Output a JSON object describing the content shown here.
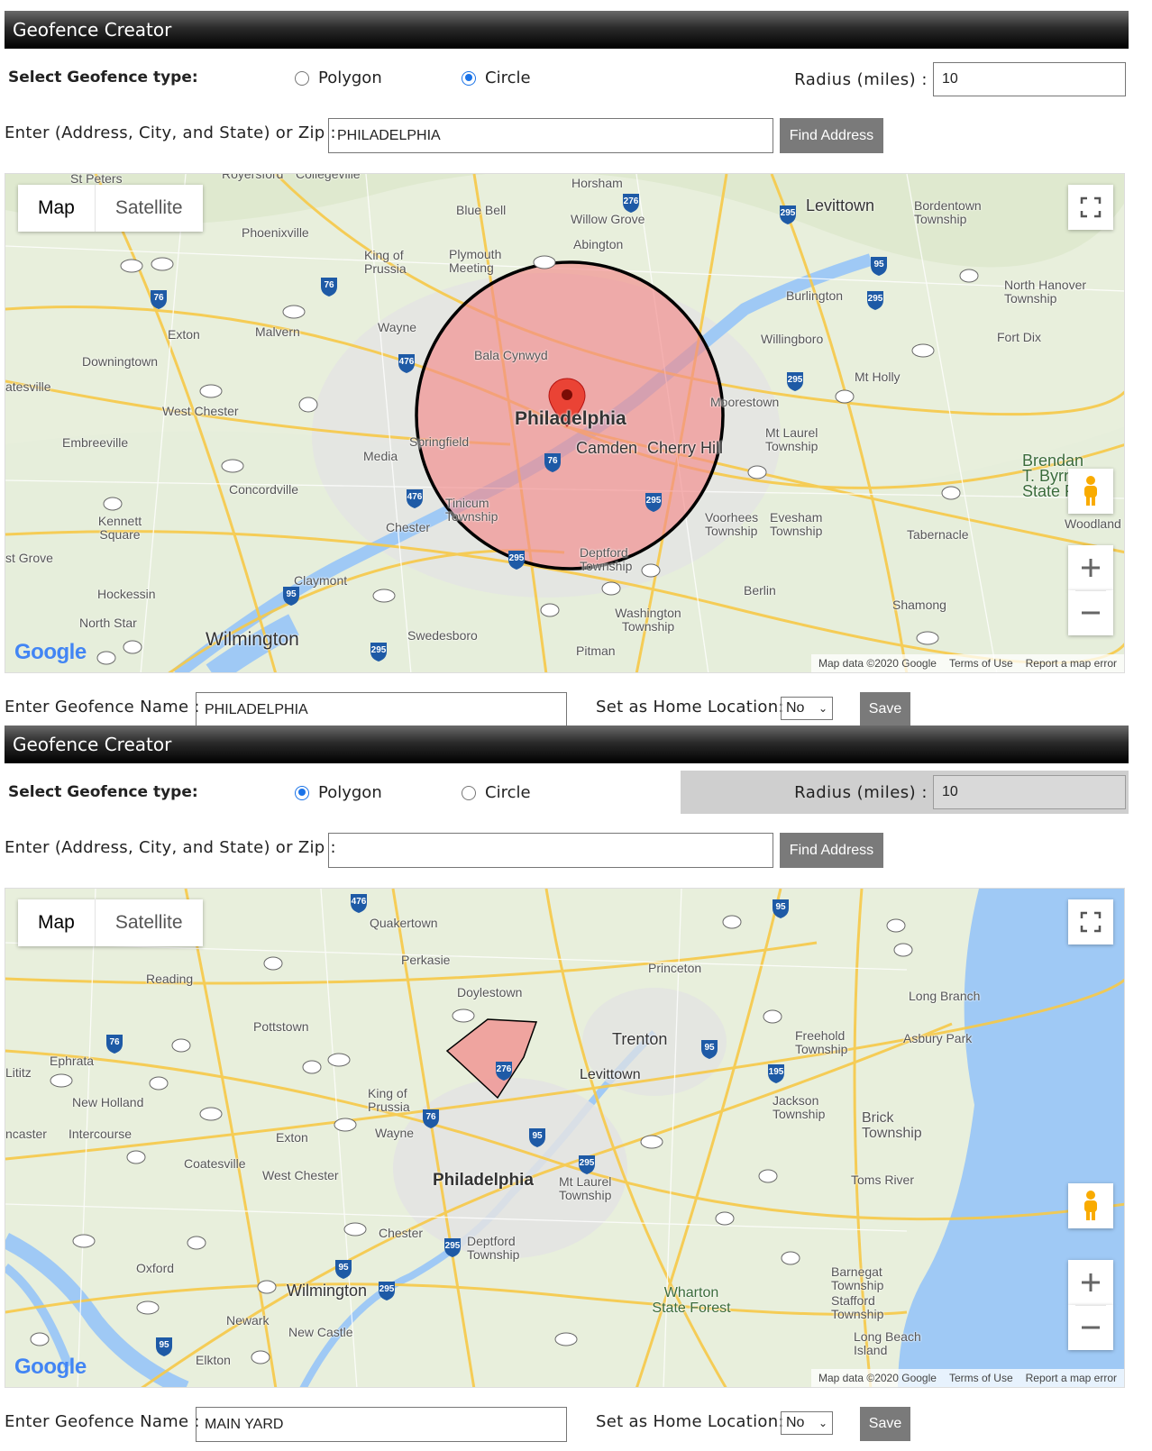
{
  "panels": [
    {
      "title": "Geofence Creator",
      "type_label": "Select Geofence type:",
      "option_polygon": "Polygon",
      "option_circle": "Circle",
      "selected_type": "Circle",
      "radius_label": "Radius (miles) :",
      "radius_value": "10",
      "radius_disabled": false,
      "address_label": "Enter (Address, City, and State) or Zip :",
      "address_value": "PHILADELPHIA",
      "find_button": "Find Address",
      "map": {
        "tab_map": "Map",
        "tab_satellite": "Satellite",
        "google": "Google",
        "attribution": {
          "map_data": "Map data ©2020 Google",
          "terms": "Terms of Use",
          "report": "Report a map error"
        },
        "labels": [
          "St Peters",
          "Royersford",
          "Collegeville",
          "Horsham",
          "Levittown",
          "Bordentown Township",
          "Blue Bell",
          "Willow Grove",
          "Phoenixville",
          "King of Prussia",
          "Plymouth Meeting",
          "Abington",
          "North Hanover Township",
          "Burlington",
          "Exton",
          "Malvern",
          "Wayne",
          "Willingboro",
          "Fort Dix",
          "Downingtown",
          "Bala Cynwyd",
          "Mt Holly",
          "atesville",
          "West Chester",
          "Moorestown",
          "Philadelphia",
          "Camden",
          "Cherry Hill",
          "Mt Laurel Township",
          "Embreeville",
          "Media",
          "Springfield",
          "Brendan T. Byrne State Fo",
          "Concordville",
          "Kennett Square",
          "Tinicum Township",
          "Chester",
          "Voorhees Township",
          "Evesham Township",
          "Tabernacle",
          "Woodland",
          "st Grove",
          "Deptford Township",
          "Claymont",
          "Hockessin",
          "Berlin",
          "Shamong",
          "North Star",
          "Wilmington",
          "Swedesboro",
          "Washington Township",
          "Pitman"
        ],
        "pin_icon": "map-pin-icon"
      },
      "name_label": "Enter Geofence Name :",
      "name_value": "PHILADELPHIA",
      "home_label": "Set as Home Location:",
      "home_value": "No",
      "save_button": "Save"
    },
    {
      "title": "Geofence Creator",
      "type_label": "Select Geofence type:",
      "option_polygon": "Polygon",
      "option_circle": "Circle",
      "selected_type": "Polygon",
      "radius_label": "Radius (miles) :",
      "radius_value": "10",
      "radius_disabled": true,
      "address_label": "Enter (Address, City, and State) or Zip :",
      "address_value": "",
      "find_button": "Find Address",
      "map": {
        "tab_map": "Map",
        "tab_satellite": "Satellite",
        "google": "Google",
        "attribution": {
          "map_data": "Map data ©2020 Google",
          "terms": "Terms of Use",
          "report": "Report a map error"
        },
        "labels": [
          "Quakertown",
          "Perkasie",
          "Princeton",
          "Reading",
          "Doylestown",
          "Long Branch",
          "Pottstown",
          "Trenton",
          "Freehold Township",
          "Asbury Park",
          "Ephrata",
          "Lititz",
          "Levittown",
          "New Holland",
          "King of Prussia",
          "Jackson Township",
          "Brick Township",
          "ncaster",
          "Intercourse",
          "Exton",
          "Wayne",
          "Coatesville",
          "West Chester",
          "Philadelphia",
          "Mt Laurel Township",
          "Toms River",
          "Oxford",
          "Chester",
          "Deptford Township",
          "Wilmington",
          "Wharton State Forest",
          "Barnegat Township",
          "Stafford Township",
          "Newark",
          "New Castle",
          "Long Beach Island",
          "Elkton"
        ]
      },
      "name_label": "Enter Geofence Name :",
      "name_value": "MAIN YARD",
      "home_label": "Set as Home Location:",
      "home_value": "No",
      "save_button": "Save"
    }
  ],
  "colors": {
    "fence_fill": "#f28b8b",
    "fence_stroke": "#000000",
    "pin": "#ea4335",
    "water": "#9fc9f5",
    "land": "#e5efd5",
    "road": "#f7c948",
    "highway_shield": "#1e5aa6",
    "radio_selected": "#1a73e8",
    "button_bg": "#7a7a7a"
  }
}
